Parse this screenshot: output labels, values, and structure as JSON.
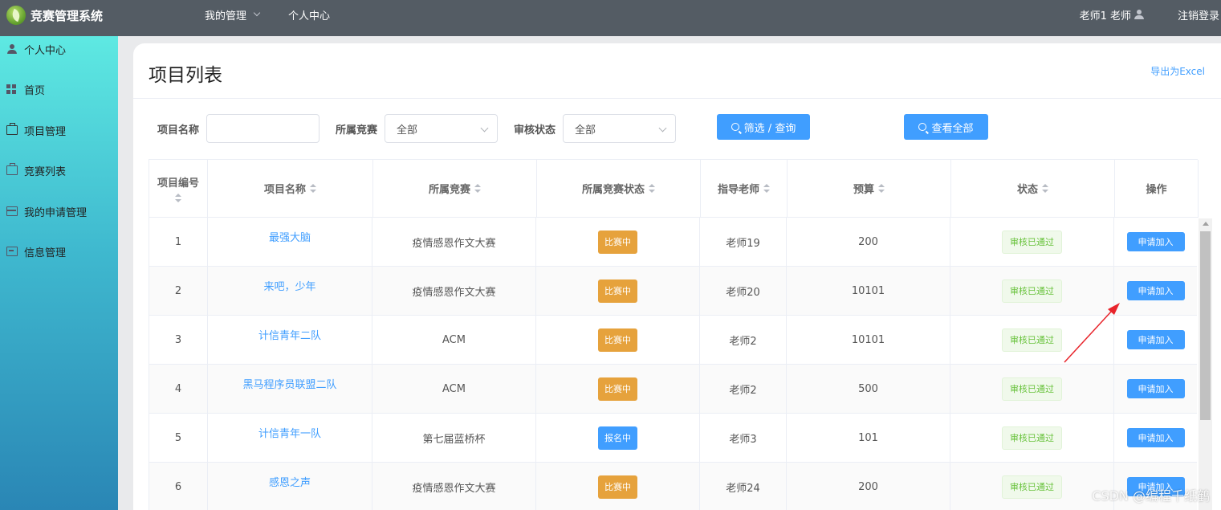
{
  "header": {
    "brand": "竞赛管理系统",
    "nav": [
      "我的管理",
      "个人中心"
    ],
    "user": "老师1 老师",
    "logout": "注销登录"
  },
  "sidebar": {
    "items": [
      {
        "label": "个人中心",
        "icon": "user-icon"
      },
      {
        "label": "首页",
        "icon": "grid-icon"
      },
      {
        "label": "项目管理",
        "icon": "briefcase-icon"
      },
      {
        "label": "竞赛列表",
        "icon": "briefcase-icon"
      },
      {
        "label": "我的申请管理",
        "icon": "card-icon"
      },
      {
        "label": "信息管理",
        "icon": "message-icon"
      }
    ]
  },
  "page": {
    "title": "项目列表",
    "export": "导出为Excel"
  },
  "filters": {
    "name_label": "项目名称",
    "name_value": "",
    "competition_label": "所属竞赛",
    "competition_value": "全部",
    "status_label": "审核状态",
    "status_value": "全部",
    "filter_button": "筛选 / 查询",
    "view_all_button": "查看全部"
  },
  "table": {
    "columns": [
      "项目编号",
      "项目名称",
      "所属竞赛",
      "所属竞赛状态",
      "指导老师",
      "预算",
      "状态",
      "操作"
    ],
    "rows": [
      {
        "id": "1",
        "name": "最强大脑",
        "competition": "疫情感恩作文大赛",
        "comp_status": "比赛中",
        "teacher": "老师19",
        "budget": "200",
        "status": "审核已通过",
        "action": "申请加入"
      },
      {
        "id": "2",
        "name": "来吧，少年",
        "competition": "疫情感恩作文大赛",
        "comp_status": "比赛中",
        "teacher": "老师20",
        "budget": "10101",
        "status": "审核已通过",
        "action": "申请加入"
      },
      {
        "id": "3",
        "name": "计信青年二队",
        "competition": "ACM",
        "comp_status": "比赛中",
        "teacher": "老师2",
        "budget": "10101",
        "status": "审核已通过",
        "action": "申请加入"
      },
      {
        "id": "4",
        "name": "黑马程序员联盟二队",
        "competition": "ACM",
        "comp_status": "比赛中",
        "teacher": "老师2",
        "budget": "500",
        "status": "审核已通过",
        "action": "申请加入"
      },
      {
        "id": "5",
        "name": "计信青年一队",
        "competition": "第七届蓝桥杯",
        "comp_status": "报名中",
        "teacher": "老师3",
        "budget": "101",
        "status": "审核已通过",
        "action": "申请加入"
      },
      {
        "id": "6",
        "name": "感恩之声",
        "competition": "疫情感恩作文大赛",
        "comp_status": "比赛中",
        "teacher": "老师24",
        "budget": "200",
        "status": "审核已通过",
        "action": "申请加入"
      }
    ]
  },
  "colors": {
    "topbar": "#545c64",
    "primary": "#409eff",
    "warning": "#e6a23c",
    "success": "#67c23a",
    "annotation": "#e8242b"
  },
  "watermark": "CSDN @编程千纸鹤"
}
